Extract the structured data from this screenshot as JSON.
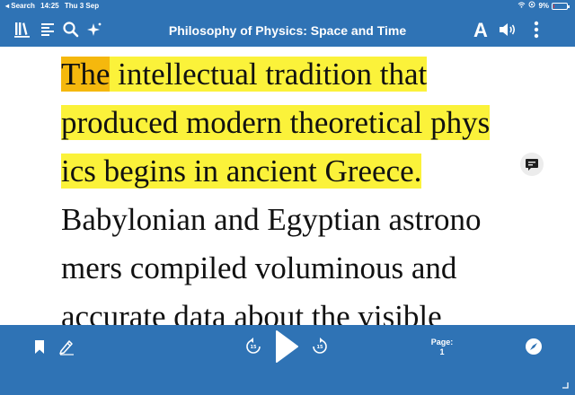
{
  "status_bar": {
    "back_label": "◂ Search",
    "time": "14:25",
    "date": "Thu 3 Sep",
    "battery_text": "9%",
    "battery_level": 0.09
  },
  "toolbar": {
    "title": "Philosophy of Physics: Space and Time",
    "font_label": "A",
    "icons": [
      "library-icon",
      "table-of-contents-icon",
      "search-icon",
      "sparkle-icon",
      "speaker-icon",
      "more-vertical-icon"
    ]
  },
  "reader": {
    "lines": [
      {
        "highlighted_word": "The",
        "rest": " intellectual tradition that",
        "highlighted": true
      },
      {
        "text": "produced modern theoretical phys",
        "highlighted": true
      },
      {
        "text": "ics begins in ancient Greece.",
        "highlighted": true
      },
      {
        "text": "Babylonian and Egyptian astrono",
        "highlighted": false
      },
      {
        "text": "mers compiled voluminous and",
        "highlighted": false
      },
      {
        "text": "accurate data about the visible",
        "highlighted": false
      }
    ],
    "colors": {
      "highlight": "#fbf23a",
      "current_word": "#f5b80d"
    }
  },
  "player": {
    "skip_back_seconds": "15",
    "skip_forward_seconds": "15",
    "page_label": "Page:",
    "page_number": "1"
  },
  "theme": {
    "bar_color": "#2f73b5"
  }
}
